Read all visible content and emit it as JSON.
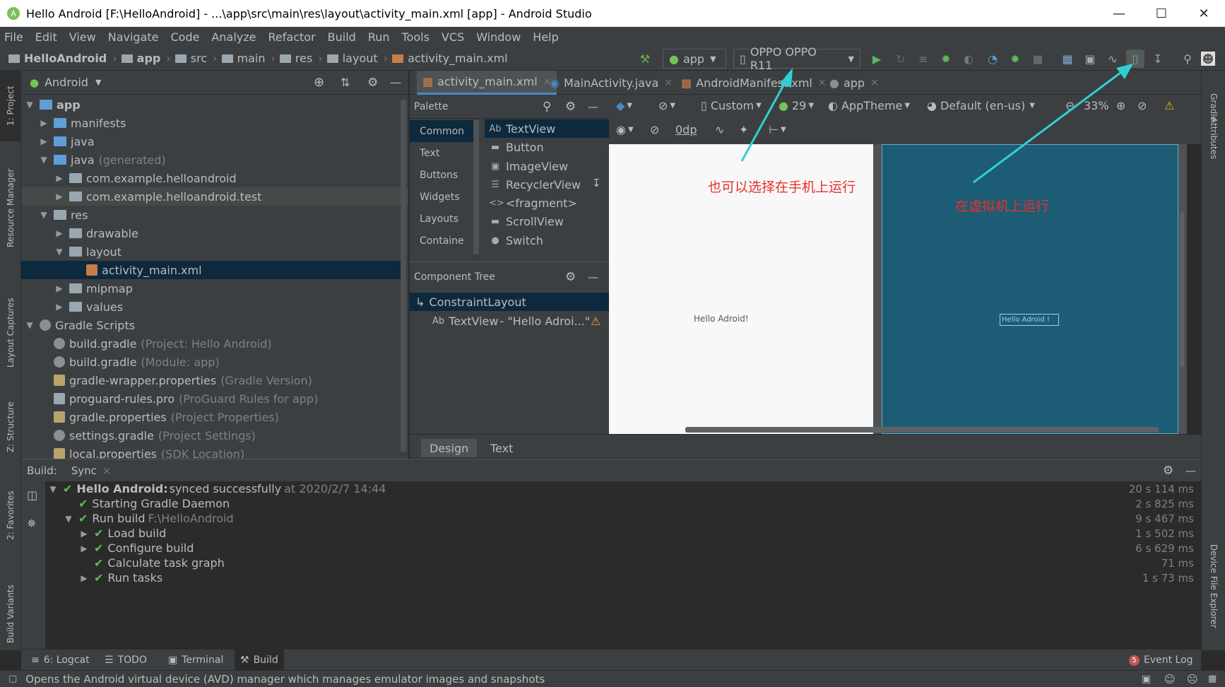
{
  "window": {
    "title": "Hello Android [F:\\HelloAndroid] - ...\\app\\src\\main\\res\\layout\\activity_main.xml [app] - Android Studio"
  },
  "menu": [
    "File",
    "Edit",
    "View",
    "Navigate",
    "Code",
    "Analyze",
    "Refactor",
    "Build",
    "Run",
    "Tools",
    "VCS",
    "Window",
    "Help"
  ],
  "breadcrumbs": [
    "HelloAndroid",
    "app",
    "src",
    "main",
    "res",
    "layout",
    "activity_main.xml"
  ],
  "toolbar": {
    "config": "app",
    "device": "OPPO OPPO R11"
  },
  "sidebar_left": [
    "1: Project",
    "Resource Manager",
    "Layout Captures",
    "Z: Structure",
    "2: Favorites",
    "Build Variants"
  ],
  "sidebar_right": [
    "Gradle",
    "Attributes",
    "Device File Explorer"
  ],
  "project": {
    "view": "Android",
    "tree": [
      {
        "label": "app",
        "hint": ""
      },
      {
        "label": "manifests",
        "hint": ""
      },
      {
        "label": "java",
        "hint": ""
      },
      {
        "label": "java",
        "hint": "(generated)"
      },
      {
        "label": "com.example.helloandroid",
        "hint": ""
      },
      {
        "label": "com.example.helloandroid.test",
        "hint": ""
      },
      {
        "label": "res",
        "hint": ""
      },
      {
        "label": "drawable",
        "hint": ""
      },
      {
        "label": "layout",
        "hint": ""
      },
      {
        "label": "activity_main.xml",
        "hint": ""
      },
      {
        "label": "mipmap",
        "hint": ""
      },
      {
        "label": "values",
        "hint": ""
      },
      {
        "label": "Gradle Scripts",
        "hint": ""
      },
      {
        "label": "build.gradle",
        "hint": "(Project: Hello Android)"
      },
      {
        "label": "build.gradle",
        "hint": "(Module: app)"
      },
      {
        "label": "gradle-wrapper.properties",
        "hint": "(Gradle Version)"
      },
      {
        "label": "proguard-rules.pro",
        "hint": "(ProGuard Rules for app)"
      },
      {
        "label": "gradle.properties",
        "hint": "(Project Properties)"
      },
      {
        "label": "settings.gradle",
        "hint": "(Project Settings)"
      },
      {
        "label": "local.properties",
        "hint": "(SDK Location)"
      }
    ]
  },
  "editor_tabs": [
    "activity_main.xml",
    "MainActivity.java",
    "AndroidManifest.xml",
    "app"
  ],
  "palette": {
    "title": "Palette",
    "categories": [
      "Common",
      "Text",
      "Buttons",
      "Widgets",
      "Layouts",
      "Containe"
    ],
    "items": [
      "TextView",
      "Button",
      "ImageView",
      "RecyclerView",
      "<fragment>",
      "ScrollView",
      "Switch"
    ]
  },
  "component_tree": {
    "title": "Component Tree",
    "root": "ConstraintLayout",
    "child": "TextView",
    "child_text": "- \"Hello Adroi...\""
  },
  "design_toolbar": {
    "device": "Custom",
    "api": "29",
    "theme": "AppTheme",
    "locale": "Default (en-us)",
    "zoom": "33%",
    "margin": "0dp"
  },
  "preview": {
    "text": "Hello Adroid!",
    "blueprint_text": "Hello Adroid !"
  },
  "annotations": {
    "phone": "也可以选择在手机上运行",
    "emulator": "在虚拟机上运行"
  },
  "design_tabs": [
    "Design",
    "Text"
  ],
  "build": {
    "label": "Build:",
    "tab": "Sync",
    "rows": [
      {
        "bold": "Hello Android:",
        "text": "synced successfully",
        "dim": "at 2020/2/7 14:44",
        "time": "20 s 114 ms"
      },
      {
        "bold": "",
        "text": "Starting Gradle Daemon",
        "dim": "",
        "time": "2 s 825 ms"
      },
      {
        "bold": "",
        "text": "Run build",
        "dim": "F:\\HelloAndroid",
        "time": "9 s 467 ms"
      },
      {
        "bold": "",
        "text": "Load build",
        "dim": "",
        "time": "1 s 502 ms"
      },
      {
        "bold": "",
        "text": "Configure build",
        "dim": "",
        "time": "6 s 629 ms"
      },
      {
        "bold": "",
        "text": "Calculate task graph",
        "dim": "",
        "time": "71 ms"
      },
      {
        "bold": "",
        "text": "Run tasks",
        "dim": "",
        "time": "1 s 73 ms"
      }
    ]
  },
  "bottom_tabs": [
    "6: Logcat",
    "TODO",
    "Terminal",
    "Build"
  ],
  "event_log": {
    "count": "5",
    "label": "Event Log"
  },
  "status": "Opens the Android virtual device (AVD) manager which manages emulator images and snapshots",
  "colors": {
    "accent": "#4a88c7",
    "check": "#5fb85d",
    "annotation": "#e8302a",
    "arrow": "#2fd0d5",
    "blueprint": "#1d5c75"
  }
}
